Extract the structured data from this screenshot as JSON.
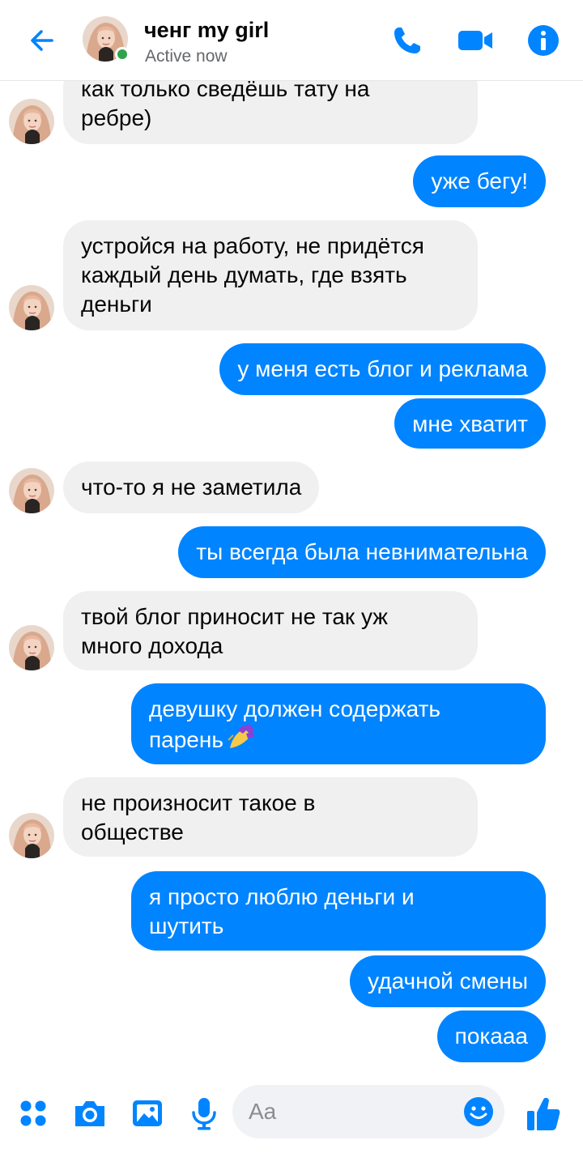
{
  "header": {
    "contact_name": "ченг my girl",
    "status": "Active now",
    "online": true,
    "icons": [
      "back-arrow-icon",
      "phone-icon",
      "video-camera-icon",
      "info-icon"
    ]
  },
  "messages": [
    {
      "from": "contact",
      "text_lines": [
        "как только сведёшь тату на",
        "ребре)"
      ]
    },
    {
      "from": "me",
      "text": "уже бегу!"
    },
    {
      "from": "contact",
      "text_lines": [
        "устройся на работу, не придётся",
        "каждый день думать, где взять",
        "деньги"
      ]
    },
    {
      "from": "me",
      "text": "у меня есть блог и реклама"
    },
    {
      "from": "me",
      "text": "мне хватит"
    },
    {
      "from": "contact",
      "text": "что-то я не заметила"
    },
    {
      "from": "me",
      "text": "ты всегда была невнимательна"
    },
    {
      "from": "contact",
      "text_lines": [
        "твой блог приносит не так уж",
        "много дохода"
      ]
    },
    {
      "from": "me",
      "text_lines": [
        "девушку должен содержать",
        "парень"
      ],
      "emoji": "nail-polish"
    },
    {
      "from": "contact",
      "text_lines": [
        "не произносит такое в",
        "обществе"
      ]
    },
    {
      "from": "me",
      "text_lines": [
        "я просто люблю деньги и",
        "шутить"
      ]
    },
    {
      "from": "me",
      "text": "удачной смены"
    },
    {
      "from": "me",
      "text": "покааа"
    }
  ],
  "composer": {
    "placeholder": "Aa",
    "icons": [
      "menu-dots-icon",
      "camera-icon",
      "gallery-icon",
      "microphone-icon",
      "emoji-icon",
      "thumbs-up-icon"
    ]
  },
  "colors": {
    "accent": "#0084ff",
    "incoming_bubble": "#f0f0f0",
    "online": "#31a24c"
  }
}
